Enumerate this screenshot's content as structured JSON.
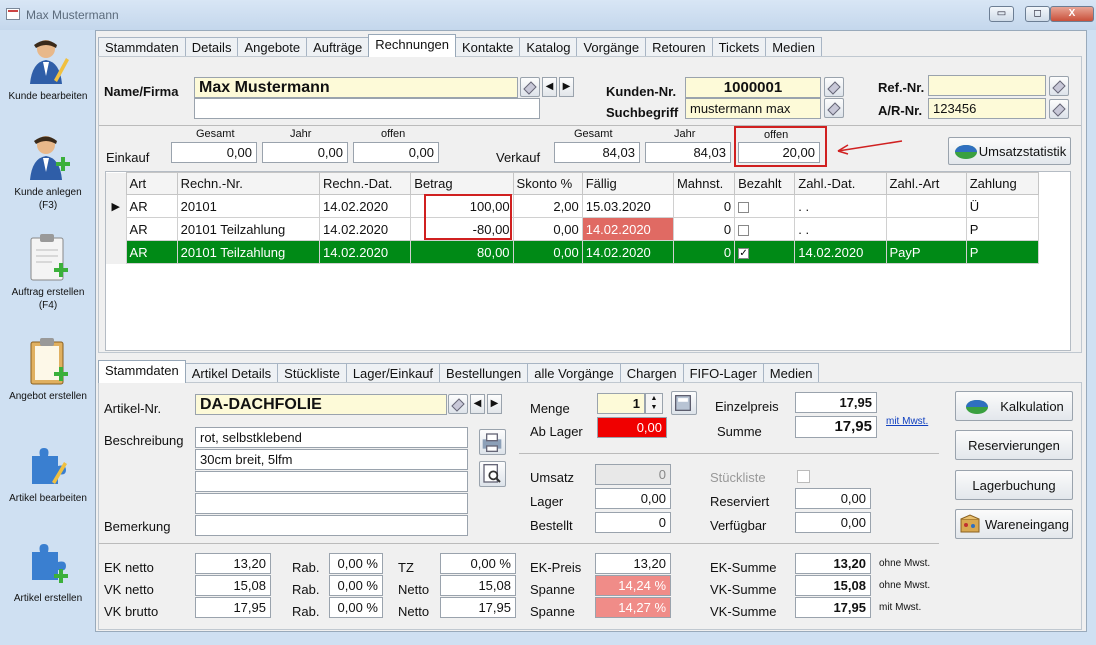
{
  "window": {
    "title": "Max Mustermann",
    "min_glyph": "▭",
    "max_glyph": "◻",
    "close_glyph": "X"
  },
  "sidebar": [
    {
      "label": "Kunde bearbeiten",
      "icon": "user-edit-icon"
    },
    {
      "label": "Kunde anlegen (F3)",
      "icon": "user-add-icon"
    },
    {
      "label": "Auftrag erstellen (F4)",
      "icon": "clipboard-add-icon"
    },
    {
      "label": "Angebot erstellen",
      "icon": "clipboard-add-icon"
    },
    {
      "label": "Artikel bearbeiten",
      "icon": "puzzle-edit-icon"
    },
    {
      "label": "Artikel erstellen",
      "icon": "puzzle-add-icon"
    }
  ],
  "top_tabs": [
    "Stammdaten",
    "Details",
    "Angebote",
    "Aufträge",
    "Rechnungen",
    "Kontakte",
    "Katalog",
    "Vorgänge",
    "Retouren",
    "Tickets",
    "Medien"
  ],
  "customer": {
    "name_label": "Name/Firma",
    "name": "Max Mustermann",
    "name2": "",
    "kunden_nr_label": "Kunden-Nr.",
    "kunden_nr": "1000001",
    "suchbegriff_label": "Suchbegriff",
    "suchbegriff": "mustermann max",
    "ref_label": "Ref.-Nr.",
    "ref": "",
    "ar_label": "A/R-Nr.",
    "ar": "123456"
  },
  "summary": {
    "einkauf_label": "Einkauf",
    "verkauf_label": "Verkauf",
    "col_gesamt": "Gesamt",
    "col_jahr": "Jahr",
    "col_offen": "offen",
    "ek_gesamt": "0,00",
    "ek_jahr": "0,00",
    "ek_offen": "0,00",
    "vk_gesamt": "84,03",
    "vk_jahr": "84,03",
    "vk_offen": "20,00",
    "umsatz_button": "Umsatzstatistik"
  },
  "invoice_table": {
    "headers": [
      "Art",
      "Rechn.-Nr.",
      "Rechn.-Dat.",
      "Betrag",
      "Skonto %",
      "Fällig",
      "Mahnst.",
      "Bezahlt",
      "Zahl.-Dat.",
      "Zahl.-Art",
      "Zahlung"
    ],
    "rows": [
      {
        "indicator": "▶",
        "art": "AR",
        "nr": "20101",
        "datum": "14.02.2020",
        "betrag": "100,00",
        "skonto": "2,00",
        "faellig": "15.03.2020",
        "mahnst": "0",
        "bezahlt": "",
        "zahl_dat": " .  .",
        "zahl_art": "",
        "zahlung": "Ü"
      },
      {
        "indicator": "",
        "art": "AR",
        "nr": "20101 Teilzahlung",
        "datum": "14.02.2020",
        "betrag": "-80,00",
        "skonto": "0,00",
        "faellig": "14.02.2020",
        "mahnst": "0",
        "bezahlt": "",
        "zahl_dat": " .  .",
        "zahl_art": "",
        "zahlung": "P"
      },
      {
        "indicator": "",
        "art": "AR",
        "nr": "20101 Teilzahlung",
        "datum": "14.02.2020",
        "betrag": "80,00",
        "skonto": "0,00",
        "faellig": "14.02.2020",
        "mahnst": "0",
        "bezahlt": "✓",
        "zahl_dat": "14.02.2020",
        "zahl_art": "PayP",
        "zahlung": "P"
      }
    ]
  },
  "bottom_tabs": [
    "Stammdaten",
    "Artikel Details",
    "Stückliste",
    "Lager/Einkauf",
    "Bestellungen",
    "alle Vorgänge",
    "Chargen",
    "FIFO-Lager",
    "Medien"
  ],
  "article": {
    "artikel_nr_label": "Artikel-Nr.",
    "artikel_nr": "DA-DACHFOLIE",
    "beschreibung_label": "Beschreibung",
    "desc": [
      "rot, selbstklebend",
      "30cm breit, 5lfm",
      "",
      ""
    ],
    "bemerkung_label": "Bemerkung",
    "bemerkung": "",
    "menge_label": "Menge",
    "menge": "1",
    "ab_lager_label": "Ab Lager",
    "ab_lager": "0,00",
    "einzelpreis_label": "Einzelpreis",
    "einzelpreis": "17,95",
    "summe_label": "Summe",
    "summe": "17,95",
    "mit_mwst_link": "mit Mwst.",
    "umsatz_label": "Umsatz",
    "umsatz": "0",
    "lager_label": "Lager",
    "lager": "0,00",
    "bestellt_label": "Bestellt",
    "bestellt": "0",
    "stueckliste_label": "Stückliste",
    "reserviert_label": "Reserviert",
    "reserviert": "0,00",
    "verfuegbar_label": "Verfügbar",
    "verfuegbar": "0,00"
  },
  "pricing": {
    "ek_netto_label": "EK netto",
    "ek_netto": "13,20",
    "vk_netto_label": "VK netto",
    "vk_netto": "15,08",
    "vk_brutto_label": "VK brutto",
    "vk_brutto": "17,95",
    "rab_label": "Rab.",
    "rab1": "0,00 %",
    "rab2": "0,00 %",
    "rab3": "0,00 %",
    "tz_label": "TZ",
    "tz": "0,00 %",
    "netto_label": "Netto",
    "netto1": "15,08",
    "netto2": "17,95",
    "ek_preis_label": "EK-Preis",
    "ek_preis": "13,20",
    "spanne_label": "Spanne",
    "spanne1": "14,24 %",
    "spanne2": "14,27 %",
    "ek_summe_label": "EK-Summe",
    "ek_summe": "13,20",
    "ek_summe_note": "ohne Mwst.",
    "vk_summe_label": "VK-Summe",
    "vk_summe1": "15,08",
    "vk_summe1_note": "ohne Mwst.",
    "vk_summe2": "17,95",
    "vk_summe2_note": "mit Mwst."
  },
  "actions": {
    "kalkulation": "Kalkulation",
    "reservierungen": "Reservierungen",
    "lagerbuchung": "Lagerbuchung",
    "wareneingang": "Wareneingang"
  },
  "colors": {
    "highlight_red": "#d02020",
    "selected_row": "#008a16",
    "warning_cell": "#e06a63",
    "field_yellow": "#fdfad8"
  }
}
